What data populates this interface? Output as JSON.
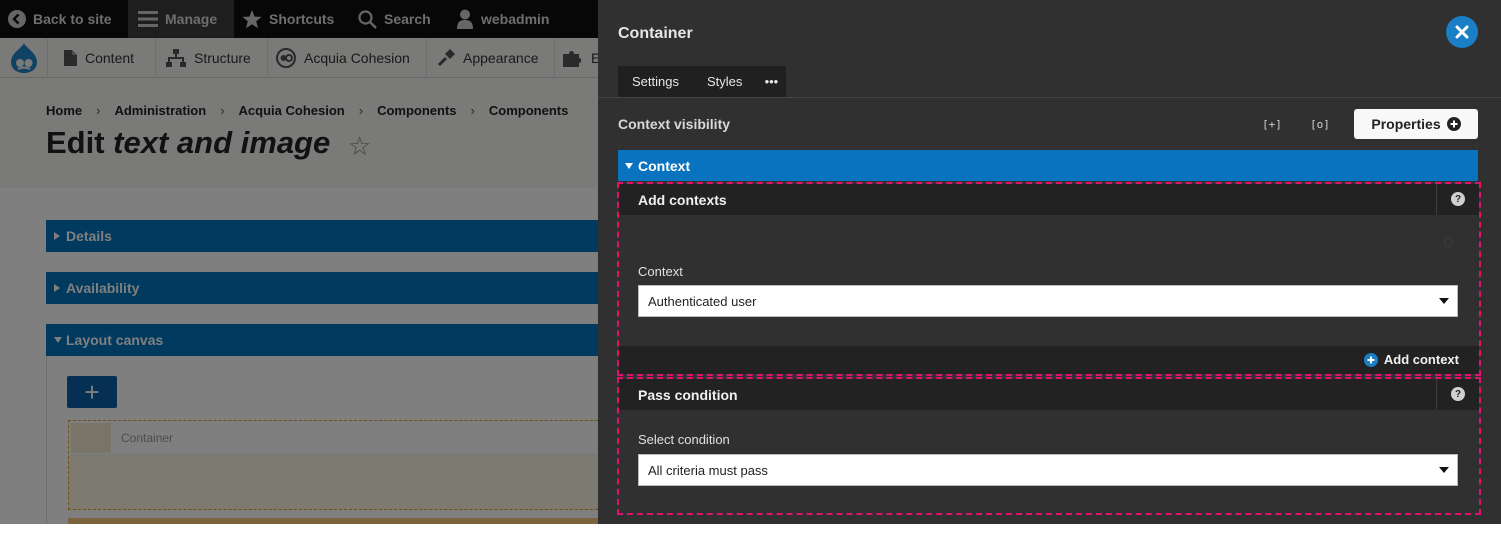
{
  "toolbar": {
    "items": [
      {
        "label": "Back to site",
        "icon": "chevron-left-circle-icon"
      },
      {
        "label": "Manage",
        "icon": "hamburger-icon",
        "active": true
      },
      {
        "label": "Shortcuts",
        "icon": "star-icon"
      },
      {
        "label": "Search",
        "icon": "search-icon"
      },
      {
        "label": "webadmin",
        "icon": "user-icon"
      }
    ]
  },
  "tray": {
    "logo_icon": "drupal-logo-icon",
    "items": [
      {
        "label": "Content",
        "icon": "document-icon"
      },
      {
        "label": "Structure",
        "icon": "structure-icon"
      },
      {
        "label": "Acquia Cohesion",
        "icon": "cohesion-icon"
      },
      {
        "label": "Appearance",
        "icon": "paint-icon"
      },
      {
        "label": "E",
        "icon": "puzzle-icon"
      }
    ]
  },
  "breadcrumb": [
    "Home",
    "Administration",
    "Acquia Cohesion",
    "Components",
    "Components"
  ],
  "page": {
    "title_prefix": "Edit ",
    "title_emphasis": "text and image",
    "star": "☆"
  },
  "accordions": {
    "details": "Details",
    "availability": "Availability",
    "layout_canvas": "Layout canvas"
  },
  "canvas": {
    "add_button": "+",
    "container_label": "Container"
  },
  "panel": {
    "title": "Container",
    "tabs": [
      "Settings",
      "Styles",
      "•••"
    ],
    "context_visibility_label": "Context visibility",
    "expand_icon_text": "[+]",
    "search_icon_text": "[o]",
    "properties_button": "Properties",
    "context_bar_label": "Context",
    "add_contexts": {
      "title": "Add contexts",
      "field_label": "Context",
      "selected_value": "Authenticated user",
      "add_link": "Add context"
    },
    "pass_condition": {
      "title": "Pass condition",
      "field_label": "Select condition",
      "selected_value": "All criteria must pass"
    },
    "help_icon": "?"
  },
  "colors": {
    "toolbar_bg": "#0f0f0f",
    "drupal_blue": "#0074bd",
    "panel_bg": "#303030",
    "section_border": "#e0126e",
    "close_button": "#1a7fc4"
  }
}
